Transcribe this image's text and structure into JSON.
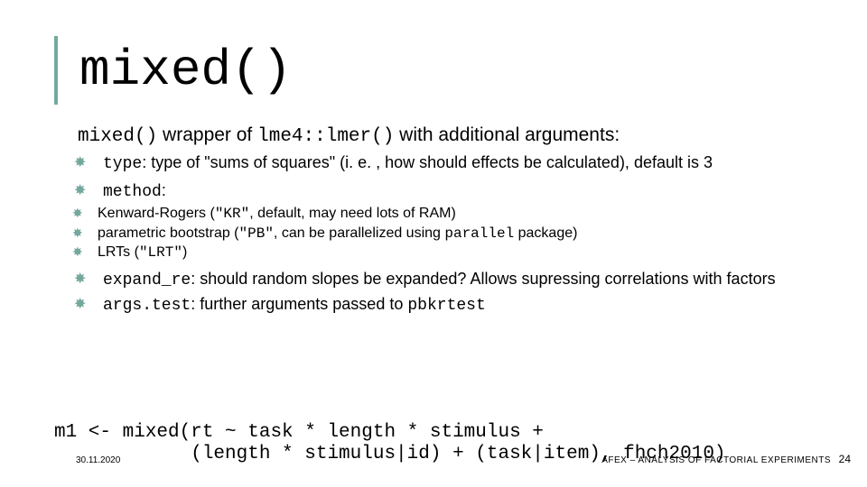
{
  "title": "mixed()",
  "intro": {
    "code1": "mixed()",
    "mid": " wrapper of ",
    "code2": "lme4::lmer()",
    "tail": " with additional arguments:"
  },
  "b1": {
    "arg": "type",
    "rest": ": type of \"sums of squares\" (i. e. , how should effects be calculated), default is 3"
  },
  "b2": {
    "arg": "method",
    "colon": ":"
  },
  "sub": {
    "kr": {
      "pre": "Kenward-Rogers (",
      "code": "\"KR\"",
      "post": ", default, may need lots of RAM)"
    },
    "pb": {
      "pre": "parametric bootstrap (",
      "code": "\"PB\"",
      "mid": ", can be parallelized using ",
      "pkg": "parallel",
      "post": " package)"
    },
    "lrt": {
      "pre": "LRTs (",
      "code": "\"LRT\"",
      "post": ")"
    }
  },
  "b3": {
    "arg": "expand_re",
    "rest": ": should random slopes be expanded? Allows supressing correlations with factors"
  },
  "b4": {
    "arg": "args.test",
    "rest": ": further arguments passed to ",
    "code": "pbkrtest"
  },
  "code_line1": "m1 <- mixed(rt ~ task * length * stimulus +",
  "code_line2": "            (length * stimulus|id) + (task|item), fhch2010)",
  "footer_date": "30.11.2020",
  "footer_right": "AFEX – ANALYSIS OF FACTORIAL EXPERIMENTS",
  "page": "24"
}
